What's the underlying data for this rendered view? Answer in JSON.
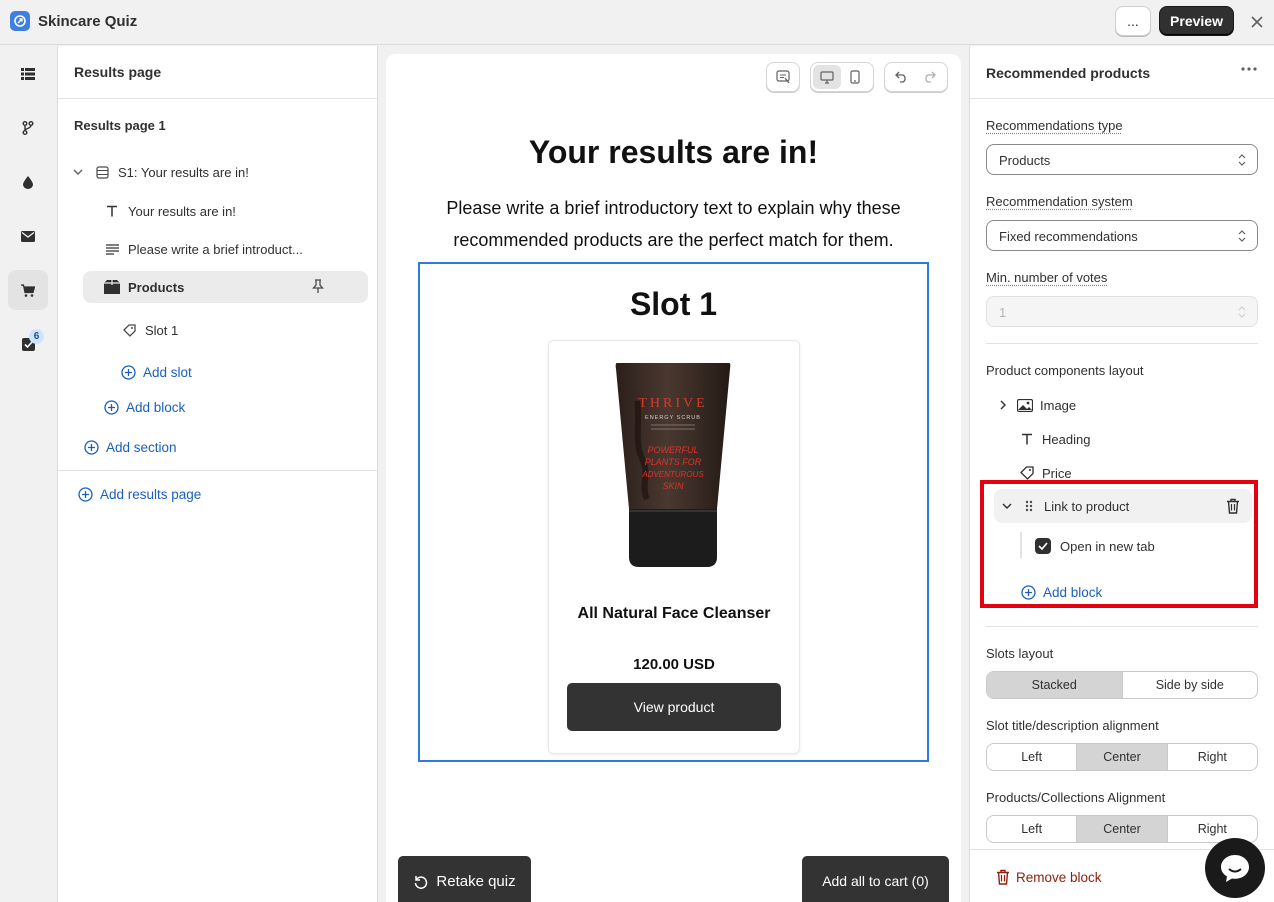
{
  "app": {
    "title": "Skincare Quiz",
    "more_label": "...",
    "preview_label": "Preview"
  },
  "rail": {
    "badge_count": "6"
  },
  "tree": {
    "header": "Results page",
    "subheader": "Results page 1",
    "section": "S1: Your results are in!",
    "blocks": [
      "Your results are in!",
      "Please write a brief introduct..."
    ],
    "products": "Products",
    "slot": "Slot 1",
    "add_slot": "Add slot",
    "add_block": "Add block",
    "add_section": "Add section",
    "add_results_page": "Add results page"
  },
  "canvas": {
    "title": "Your results are in!",
    "intro": "Please write a brief introductory text to explain why these recommended products are the perfect match for them.",
    "slot_title": "Slot 1",
    "product": {
      "name": "All Natural Face Cleanser",
      "price": "120.00 USD",
      "button": "View product"
    },
    "retake": "Retake quiz",
    "add_all": "Add all to cart (0)",
    "tube": {
      "brand": "THRIVE",
      "subtitle": "ENERGY SCRUB",
      "tagline": [
        "POWERFUL",
        "PLANTS FOR",
        "ADVENTUROUS",
        "SKIN"
      ]
    }
  },
  "panel": {
    "title": "Recommended products",
    "rec_type_label": "Recommendations type",
    "rec_type_value": "Products",
    "rec_system_label": "Recommendation system",
    "rec_system_value": "Fixed recommendations",
    "min_votes_label": "Min. number of votes",
    "min_votes_value": "1",
    "components_label": "Product components layout",
    "components": [
      "Image",
      "Heading",
      "Price",
      "Link to product"
    ],
    "open_new_tab": "Open in new tab",
    "open_new_tab_checked": true,
    "add_block": "Add block",
    "slots_layout_label": "Slots layout",
    "slots_layout_options": [
      "Stacked",
      "Side by side"
    ],
    "slots_layout_selected": "Stacked",
    "slot_align_label": "Slot title/description alignment",
    "slot_align_options": [
      "Left",
      "Center",
      "Right"
    ],
    "slot_align_selected": "Center",
    "prod_align_label": "Products/Collections Alignment",
    "prod_align_options": [
      "Left",
      "Center",
      "Right"
    ],
    "prod_align_selected": "Center",
    "remove_block": "Remove block"
  },
  "colors": {
    "accent": "#2d7be0",
    "link": "#1a5fbf",
    "highlight": "#e3000f",
    "primary_button": "#303030",
    "danger": "#8e1f0b"
  }
}
